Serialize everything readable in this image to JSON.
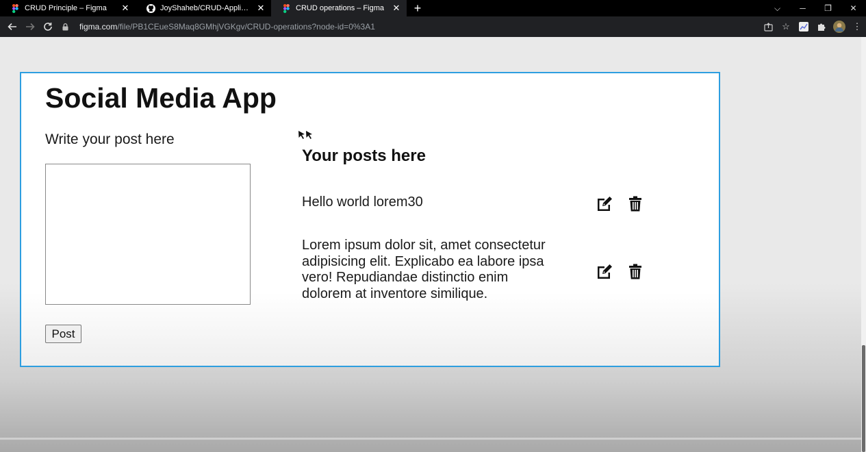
{
  "browser": {
    "tabs": [
      {
        "title": "CRUD Principle – Figma",
        "icon": "figma-icon",
        "active": false
      },
      {
        "title": "JoyShaheb/CRUD-Application",
        "icon": "github-icon",
        "active": false
      },
      {
        "title": "CRUD operations – Figma",
        "icon": "figma-icon",
        "active": true
      }
    ],
    "url_host": "figma.com",
    "url_rest": "/file/PB1CEueS8Maq8GMhjVGKgv/CRUD-operations?node-id=0%3A1"
  },
  "app": {
    "title": "Social Media App",
    "write_label": "Write your post here",
    "textarea_value": "",
    "post_button": "Post",
    "posts_heading": "Your posts here",
    "posts": [
      {
        "text": "Hello world lorem30"
      },
      {
        "text": "Lorem ipsum dolor sit, amet consectetur adipisicing elit. Explicabo ea labore ipsa vero! Repudiandae distinctio enim dolorem at inventore similique."
      }
    ]
  },
  "colors": {
    "frame_border": "#2d9ee0",
    "page_bg": "#e9e9e9",
    "browser_chrome": "#202124"
  }
}
